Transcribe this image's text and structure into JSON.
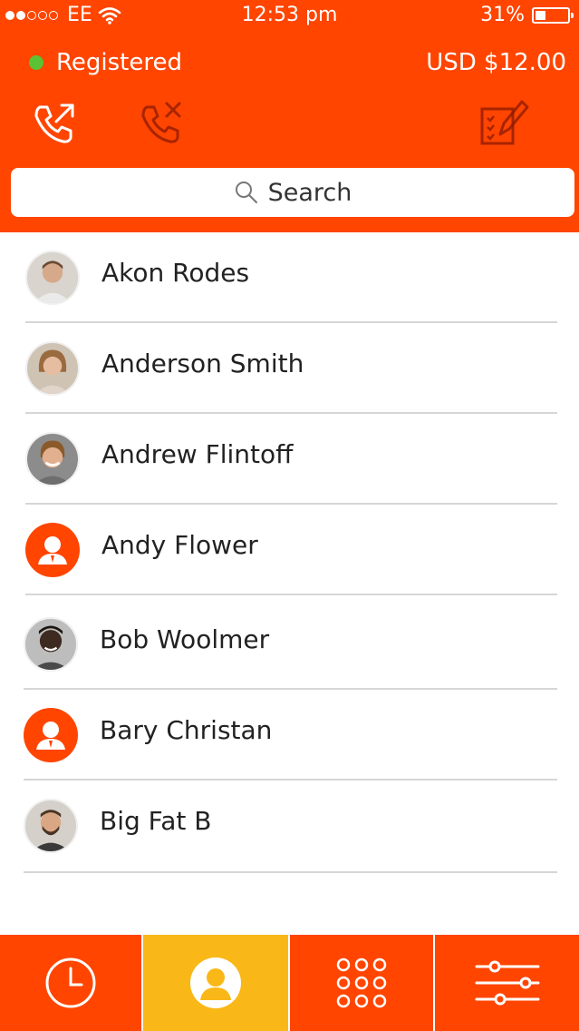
{
  "status_bar": {
    "carrier": "EE",
    "time": "12:53 pm",
    "battery": "31%",
    "battery_level": 0.31,
    "signal_bars_filled": 2,
    "signal_bars_total": 5
  },
  "header": {
    "status_label": "Registered",
    "status_color": "#5BC236",
    "balance": "USD $12.00",
    "icons": [
      "outgoing-call-icon",
      "missed-call-icon",
      "notes-edit-icon"
    ],
    "accent_color": "#FF4500"
  },
  "search": {
    "placeholder": "Search",
    "icon": "search-icon"
  },
  "contacts": [
    {
      "name": "Akon Rodes",
      "avatar": "photo"
    },
    {
      "name": "Anderson Smith",
      "avatar": "photo"
    },
    {
      "name": "Andrew Flintoff",
      "avatar": "photo"
    },
    {
      "name": "Andy Flower",
      "avatar": "default-user"
    },
    {
      "name": "Bob Woolmer",
      "avatar": "photo"
    },
    {
      "name": "Bary Christan",
      "avatar": "default-user"
    },
    {
      "name": "Big Fat B",
      "avatar": "photo"
    }
  ],
  "tab_bar": {
    "tabs": [
      {
        "icon": "clock-icon",
        "active": false
      },
      {
        "icon": "contacts-icon",
        "active": true
      },
      {
        "icon": "dialpad-icon",
        "active": false
      },
      {
        "icon": "settings-sliders-icon",
        "active": false
      }
    ],
    "active_color": "#F9B818"
  }
}
